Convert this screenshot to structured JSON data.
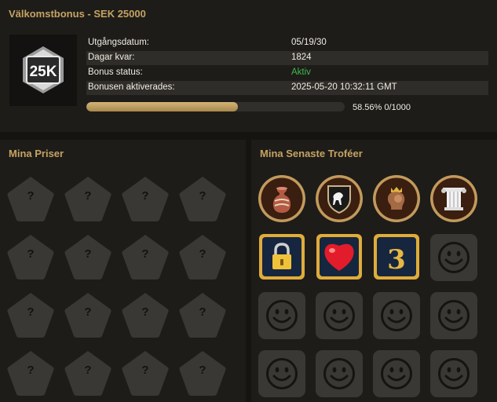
{
  "bonus": {
    "title": "Välkomstbonus - SEK 25000",
    "badge_text": "25K",
    "rows": [
      {
        "label": "Utgångsdatum:",
        "value": "05/19/30"
      },
      {
        "label": "Dagar kvar:",
        "value": "1824"
      },
      {
        "label": "Bonus status:",
        "value": "Aktiv"
      },
      {
        "label": "Bonusen aktiverades:",
        "value": "2025-05-20 10:32:11 GMT"
      }
    ],
    "progress_fraction": 0.5856,
    "progress_text": "58.56% 0/1000"
  },
  "prizes": {
    "title": "Mina Priser",
    "items": [
      "?",
      "?",
      "?",
      "?",
      "?",
      "?",
      "?",
      "?",
      "?",
      "?",
      "?",
      "?",
      "?",
      "?",
      "?",
      "?"
    ]
  },
  "trophies": {
    "title": "Mina Senaste Troféer",
    "earned": [
      "vase-trophy-icon",
      "horse-shield-trophy-icon",
      "queen-trophy-icon",
      "column-trophy-icon",
      "padlock-trophy-icon",
      "heart-trophy-icon",
      "number-three-trophy-icon"
    ],
    "locked_count": 9
  },
  "colors": {
    "accent": "#c6a362",
    "status_active": "#3fb84b",
    "background": "#151411",
    "panel": "#1d1c19"
  }
}
